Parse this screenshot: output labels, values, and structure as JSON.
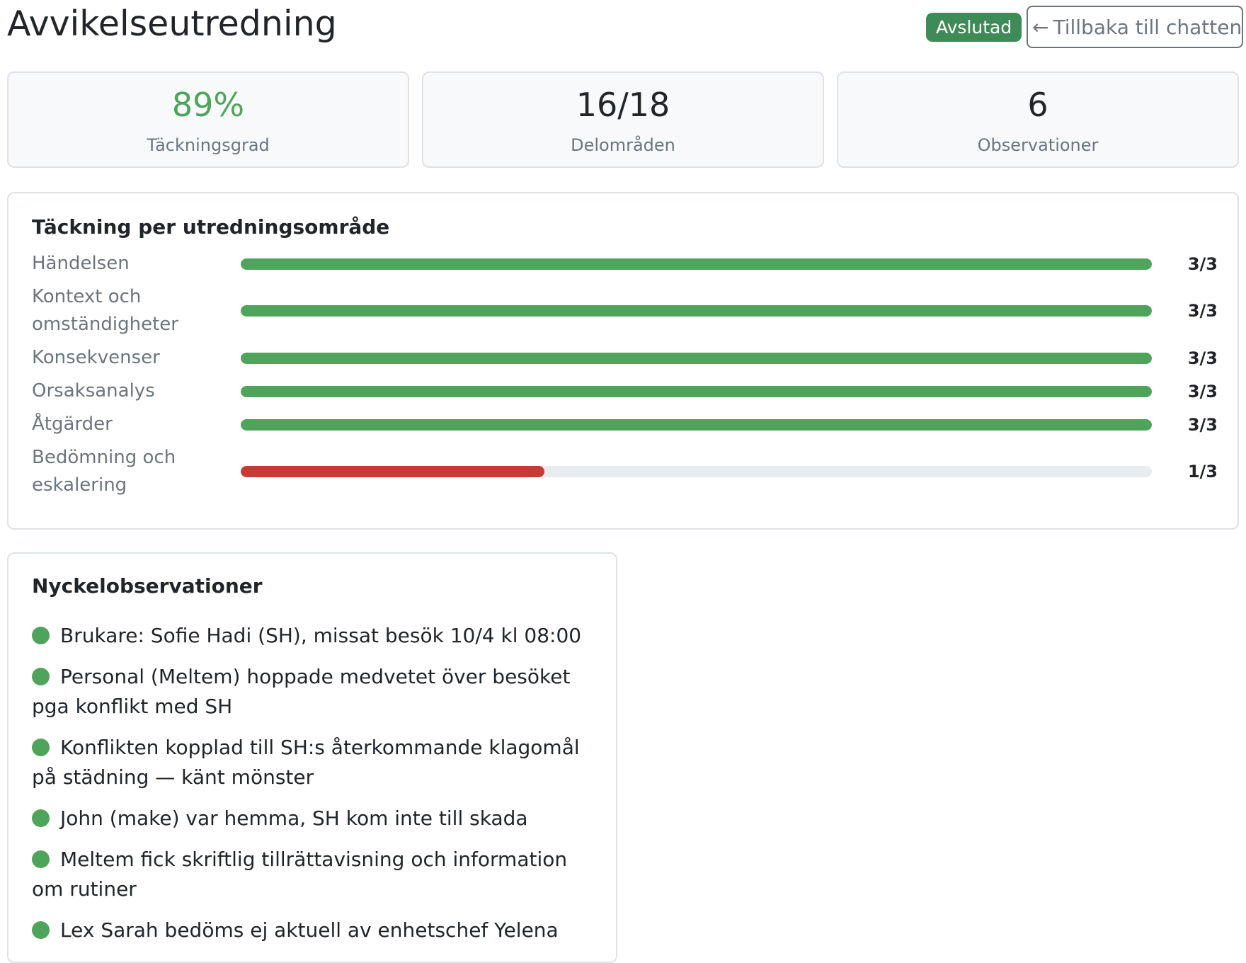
{
  "header": {
    "title": "Avvikelseutredning",
    "status": "Avslutad",
    "back_button": "Tillbaka till chatten",
    "back_icon": "arrow-left-icon"
  },
  "stats": [
    {
      "value": "89%",
      "label": "Täckningsgrad"
    },
    {
      "value": "16/18",
      "label": "Delområden"
    },
    {
      "value": "6",
      "label": "Observationer"
    }
  ],
  "coverage": {
    "title": "Täckning per utredningsområde",
    "rows": [
      {
        "label": "Händelsen",
        "score": "3/3",
        "completed": 3,
        "total": 3
      },
      {
        "label": "Kontext och omständigheter",
        "score": "3/3",
        "completed": 3,
        "total": 3
      },
      {
        "label": "Konsekvenser",
        "score": "3/3",
        "completed": 3,
        "total": 3
      },
      {
        "label": "Orsaksanalys",
        "score": "3/3",
        "completed": 3,
        "total": 3
      },
      {
        "label": "Åtgärder",
        "score": "3/3",
        "completed": 3,
        "total": 3
      },
      {
        "label": "Bedömning och eskalering",
        "score": "1/3",
        "completed": 1,
        "total": 3
      }
    ]
  },
  "observations": {
    "title": "Nyckelobservationer",
    "items": [
      "Brukare: Sofie Hadi (SH), missat besök 10/4 kl 08:00",
      "Personal (Meltem) hoppade medvetet över besöket pga konflikt med SH",
      "Konflikten kopplad till SH:s återkommande klagomål på städning — känt mönster",
      "John (make) var hemma, SH kom inte till skada",
      "Meltem fick skriftlig tillrättavisning och information om rutiner",
      "Lex Sarah bedöms ej aktuell av enhetschef Yelena"
    ]
  },
  "colors": {
    "accent_green": "#4ea45b",
    "badge_green": "#3f8b57",
    "bar_complete": "#4ea45b",
    "bar_incomplete": "#c93a34",
    "track": "#e9ecef"
  }
}
